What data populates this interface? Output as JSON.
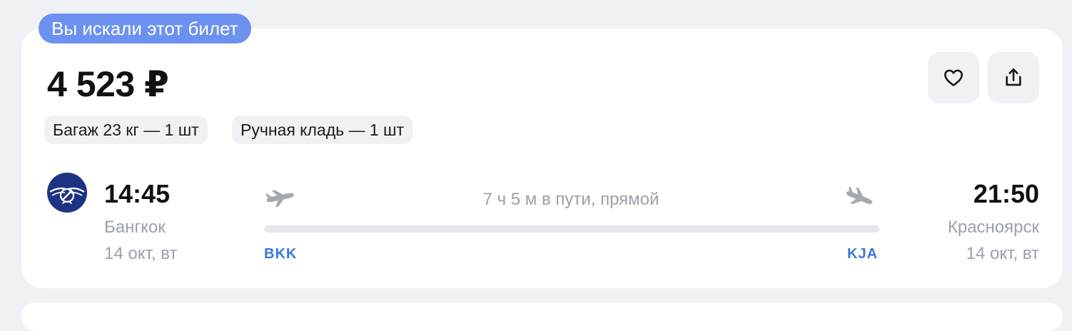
{
  "badge": {
    "label": "Вы искали этот билет",
    "color": "#6c91f0"
  },
  "ticket": {
    "price": "4 523 ₽",
    "actions": {
      "favorite_icon": "heart-icon",
      "share_icon": "share-icon"
    },
    "baggage": {
      "checked": "Багаж 23 кг — 1 шт",
      "carry_on": "Ручная кладь — 1 шт"
    },
    "airline_logo": "airline-logo",
    "flight": {
      "departure": {
        "time": "14:45",
        "city": "Бангкок",
        "date": "14 окт, вт",
        "iata": "BKK"
      },
      "arrival": {
        "time": "21:50",
        "city": "Красноярск",
        "date": "14 окт, вт",
        "iata": "KJA"
      },
      "duration": "7 ч 5 м в пути, прямой"
    }
  },
  "colors": {
    "background": "#eff1f4",
    "iata": "#3a76e0",
    "muted": "#9aa0a9"
  }
}
